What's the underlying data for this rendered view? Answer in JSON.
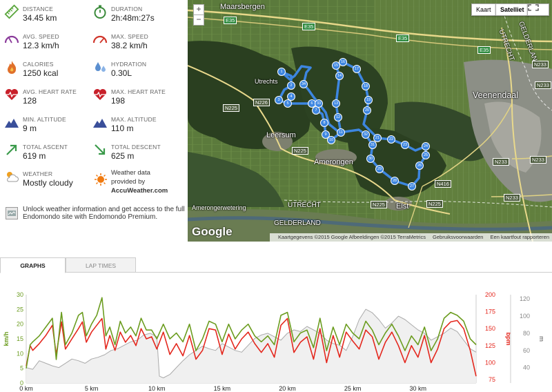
{
  "stats": [
    {
      "label": "DISTANCE",
      "value": "34.45 km",
      "icon": "ruler-icon",
      "color": "#5aa63c"
    },
    {
      "label": "DURATION",
      "value": "2h:48m:27s",
      "icon": "stopwatch-icon",
      "color": "#3a8a3a"
    },
    {
      "label": "AVG. SPEED",
      "value": "12.3 km/h",
      "icon": "speedometer-icon",
      "color": "#8a3a9a"
    },
    {
      "label": "MAX. SPEED",
      "value": "38.2 km/h",
      "icon": "speedometer-icon",
      "color": "#d0352a"
    },
    {
      "label": "CALORIES",
      "value": "1250 kcal",
      "icon": "flame-icon",
      "color": "#e0702a"
    },
    {
      "label": "HYDRATION",
      "value": "0.30L",
      "icon": "water-drops-icon",
      "color": "#5b8fd0"
    },
    {
      "label": "AVG. HEART RATE",
      "value": "128",
      "icon": "heart-pulse-icon",
      "color": "#c8202a"
    },
    {
      "label": "MAX. HEART RATE",
      "value": "198",
      "icon": "heart-pulse-icon",
      "color": "#c8202a"
    },
    {
      "label": "MIN. ALTITUDE",
      "value": "9 m",
      "icon": "mountain-icon",
      "color": "#3a4f9a"
    },
    {
      "label": "MAX. ALTITUDE",
      "value": "110 m",
      "icon": "mountain-icon",
      "color": "#3a4f9a"
    },
    {
      "label": "TOTAL ASCENT",
      "value": "619 m",
      "icon": "arrow-up-right-icon",
      "color": "#3a9a4a"
    },
    {
      "label": "TOTAL DESCENT",
      "value": "625 m",
      "icon": "arrow-down-right-icon",
      "color": "#3a9a4a"
    },
    {
      "label": "WEATHER",
      "value": "Mostly cloudy",
      "icon": "cloud-sun-icon",
      "color": "#f0a020"
    }
  ],
  "weather_data": {
    "line1": "Weather data",
    "line2": "provided by",
    "brand": "AccuWeather.com",
    "icon": "accuweather-sun-icon"
  },
  "promo": {
    "text": "Unlock weather information and get access to the full Endomondo site with Endomondo Premium.",
    "icon": "premium-icon"
  },
  "map": {
    "map_type_map": "Kaart",
    "map_type_satellite": "Satelliet",
    "zoom_in": "+",
    "zoom_out": "−",
    "attribution": "Kaartgegevens ©2015 Google Afbeeldingen ©2015 TerraMetrics",
    "terms": "Gebruiksvoorwaarden",
    "report": "Een kaartfout rapporteren",
    "google_logo": "Google",
    "places": {
      "maarsbergen": "Maarsbergen",
      "veenendaal": "Veenendaal",
      "leersum": "Leersum",
      "amerongen": "Amerongen",
      "elst": "Elst",
      "utrechts": "Utrechts",
      "rivier": "Amerongerwetering",
      "utrecht_1": "UTRECHT",
      "utrecht_2": "UTRECHT",
      "gelderland_1": "GELDERLAND",
      "gelderland_2": "GELDERLAND"
    },
    "roads": {
      "e35a": "E35",
      "e35b": "E35",
      "e35c": "E35",
      "e35d": "E35",
      "n226": "N226",
      "n225a": "N225",
      "n225b": "N225",
      "n225c": "N225",
      "n225d": "N225",
      "n233a": "N233",
      "n233b": "N233",
      "n233c": "N233",
      "n233d": "N233",
      "n233e": "N233",
      "n416": "N416"
    },
    "route_markers": [
      "1",
      "2",
      "3",
      "4",
      "5",
      "6",
      "7",
      "8",
      "9",
      "10",
      "11",
      "12",
      "13",
      "14",
      "15",
      "16",
      "17",
      "18",
      "19",
      "20",
      "21",
      "22",
      "23",
      "24",
      "25",
      "26",
      "27",
      "28",
      "29",
      "30",
      "31",
      "32",
      "33",
      "34"
    ],
    "route_color": "#3d86e0"
  },
  "tabs": {
    "graphs": "GRAPHS",
    "lap_times": "LAP TIMES"
  },
  "chart_data": {
    "type": "line",
    "xlabel": "",
    "x_unit": "km",
    "x_ticks": [
      "0 km",
      "5 km",
      "10 km",
      "15 km",
      "20 km",
      "25 km",
      "30 km"
    ],
    "xlim": [
      0,
      34.45
    ],
    "y_left": {
      "label": "km/h",
      "ticks": [
        0,
        5,
        10,
        15,
        20,
        25,
        30
      ],
      "ylim": [
        0,
        30
      ],
      "color": "#6b9c1f"
    },
    "y_right1": {
      "label": "bpm",
      "ticks": [
        75,
        100,
        125,
        150,
        175,
        200
      ],
      "ylim": [
        70,
        200
      ],
      "color": "#e4271d"
    },
    "y_right2": {
      "label": "m",
      "ticks": [
        40,
        60,
        80,
        100,
        120
      ],
      "ylim": [
        22,
        125
      ],
      "color": "#999999"
    },
    "series": [
      {
        "name": "km/h",
        "axis": "left",
        "color": "#6b9c1f",
        "x": [
          0,
          0.3,
          0.5,
          1,
          1.5,
          2,
          2.3,
          2.7,
          3,
          3.5,
          4,
          4.3,
          4.6,
          5,
          5.4,
          5.8,
          6.1,
          6.4,
          6.8,
          7.2,
          7.6,
          8,
          8.4,
          8.8,
          9.2,
          9.6,
          10,
          10.5,
          11,
          11.5,
          12,
          12.5,
          13,
          13.5,
          14,
          14.5,
          15,
          15.5,
          16,
          16.5,
          17,
          17.5,
          18,
          18.5,
          19,
          19.5,
          20,
          20.5,
          21,
          21.5,
          22,
          22.5,
          23,
          23.5,
          24,
          24.5,
          25,
          25.5,
          26,
          26.5,
          27,
          27.5,
          28,
          28.5,
          29,
          29.5,
          30,
          30.5,
          31,
          31.5,
          32,
          32.5,
          33,
          33.5,
          34,
          34.45
        ],
        "values": [
          5,
          13,
          14,
          16,
          19,
          22,
          8,
          24,
          13,
          17,
          23,
          24,
          16,
          20,
          23,
          29,
          16,
          19,
          13,
          21,
          17,
          19,
          16,
          22,
          18,
          18,
          15,
          20,
          15,
          17,
          14,
          20,
          11,
          15,
          21,
          20,
          14,
          20,
          15,
          18,
          20,
          16,
          14,
          16,
          13,
          23,
          24,
          14,
          17,
          18,
          12,
          22,
          11,
          19,
          13,
          20,
          17,
          15,
          21,
          18,
          13,
          17,
          20,
          16,
          11,
          16,
          13,
          19,
          11,
          15,
          22,
          24,
          23,
          21,
          15,
          13
        ]
      },
      {
        "name": "bpm",
        "axis": "right1",
        "color": "#e4271d",
        "x": [
          0,
          0.3,
          0.5,
          1,
          1.5,
          2,
          2.3,
          2.7,
          3,
          3.5,
          4,
          4.3,
          4.6,
          5,
          5.4,
          5.8,
          6.1,
          6.4,
          6.8,
          7.2,
          7.6,
          8,
          8.4,
          8.8,
          9.2,
          9.6,
          10,
          10.5,
          11,
          11.5,
          12,
          12.5,
          13,
          13.5,
          14,
          14.5,
          15,
          15.5,
          16,
          16.5,
          17,
          17.5,
          18,
          18.5,
          19,
          19.5,
          20,
          20.5,
          21,
          21.5,
          22,
          22.5,
          23,
          23.5,
          24,
          24.5,
          25,
          25.5,
          26,
          26.5,
          27,
          27.5,
          28,
          28.5,
          29,
          29.5,
          30,
          30.5,
          31,
          31.5,
          32,
          32.5,
          33,
          33.5,
          34,
          34.45
        ],
        "values": [
          95,
          125,
          118,
          128,
          140,
          155,
          112,
          160,
          120,
          135,
          150,
          160,
          130,
          145,
          155,
          165,
          120,
          140,
          118,
          145,
          130,
          140,
          125,
          150,
          135,
          138,
          120,
          145,
          112,
          128,
          110,
          140,
          105,
          118,
          150,
          148,
          112,
          142,
          120,
          135,
          145,
          128,
          115,
          128,
          108,
          155,
          165,
          115,
          130,
          138,
          105,
          150,
          100,
          140,
          108,
          145,
          132,
          120,
          148,
          138,
          105,
          130,
          145,
          125,
          100,
          125,
          108,
          140,
          100,
          120,
          150,
          160,
          162,
          150,
          118,
          80
        ]
      },
      {
        "name": "m",
        "axis": "right2",
        "color": "#aaaaaa",
        "x": [
          0,
          0.5,
          1,
          1.5,
          2,
          2.5,
          3,
          3.5,
          4,
          4.5,
          5,
          5.5,
          6,
          6.5,
          7,
          7.5,
          8,
          8.5,
          9,
          9.5,
          10,
          10.2,
          10.5,
          11,
          11.5,
          12,
          12.5,
          13,
          13.5,
          14,
          14.5,
          15,
          15.5,
          16,
          16.5,
          17,
          17.5,
          18,
          18.5,
          19,
          19.5,
          20,
          20.5,
          21,
          21.5,
          22,
          22.5,
          23,
          23.5,
          24,
          24.5,
          25,
          25.5,
          26,
          26.5,
          27,
          27.5,
          28,
          28.5,
          29,
          29.5,
          30,
          30.5,
          31,
          31.5,
          32,
          32.5,
          33,
          33.5,
          34,
          34.45
        ],
        "values": [
          40,
          38,
          48,
          45,
          42,
          40,
          45,
          50,
          48,
          45,
          50,
          52,
          55,
          60,
          62,
          66,
          70,
          72,
          78,
          80,
          76,
          30,
          28,
          32,
          40,
          48,
          55,
          60,
          65,
          62,
          60,
          68,
          64,
          60,
          58,
          66,
          74,
          78,
          80,
          76,
          72,
          80,
          84,
          82,
          88,
          84,
          80,
          72,
          68,
          66,
          60,
          76,
          96,
          108,
          104,
          96,
          86,
          92,
          100,
          96,
          90,
          84,
          80,
          72,
          76,
          80,
          86,
          82,
          72,
          62,
          58
        ]
      }
    ]
  }
}
